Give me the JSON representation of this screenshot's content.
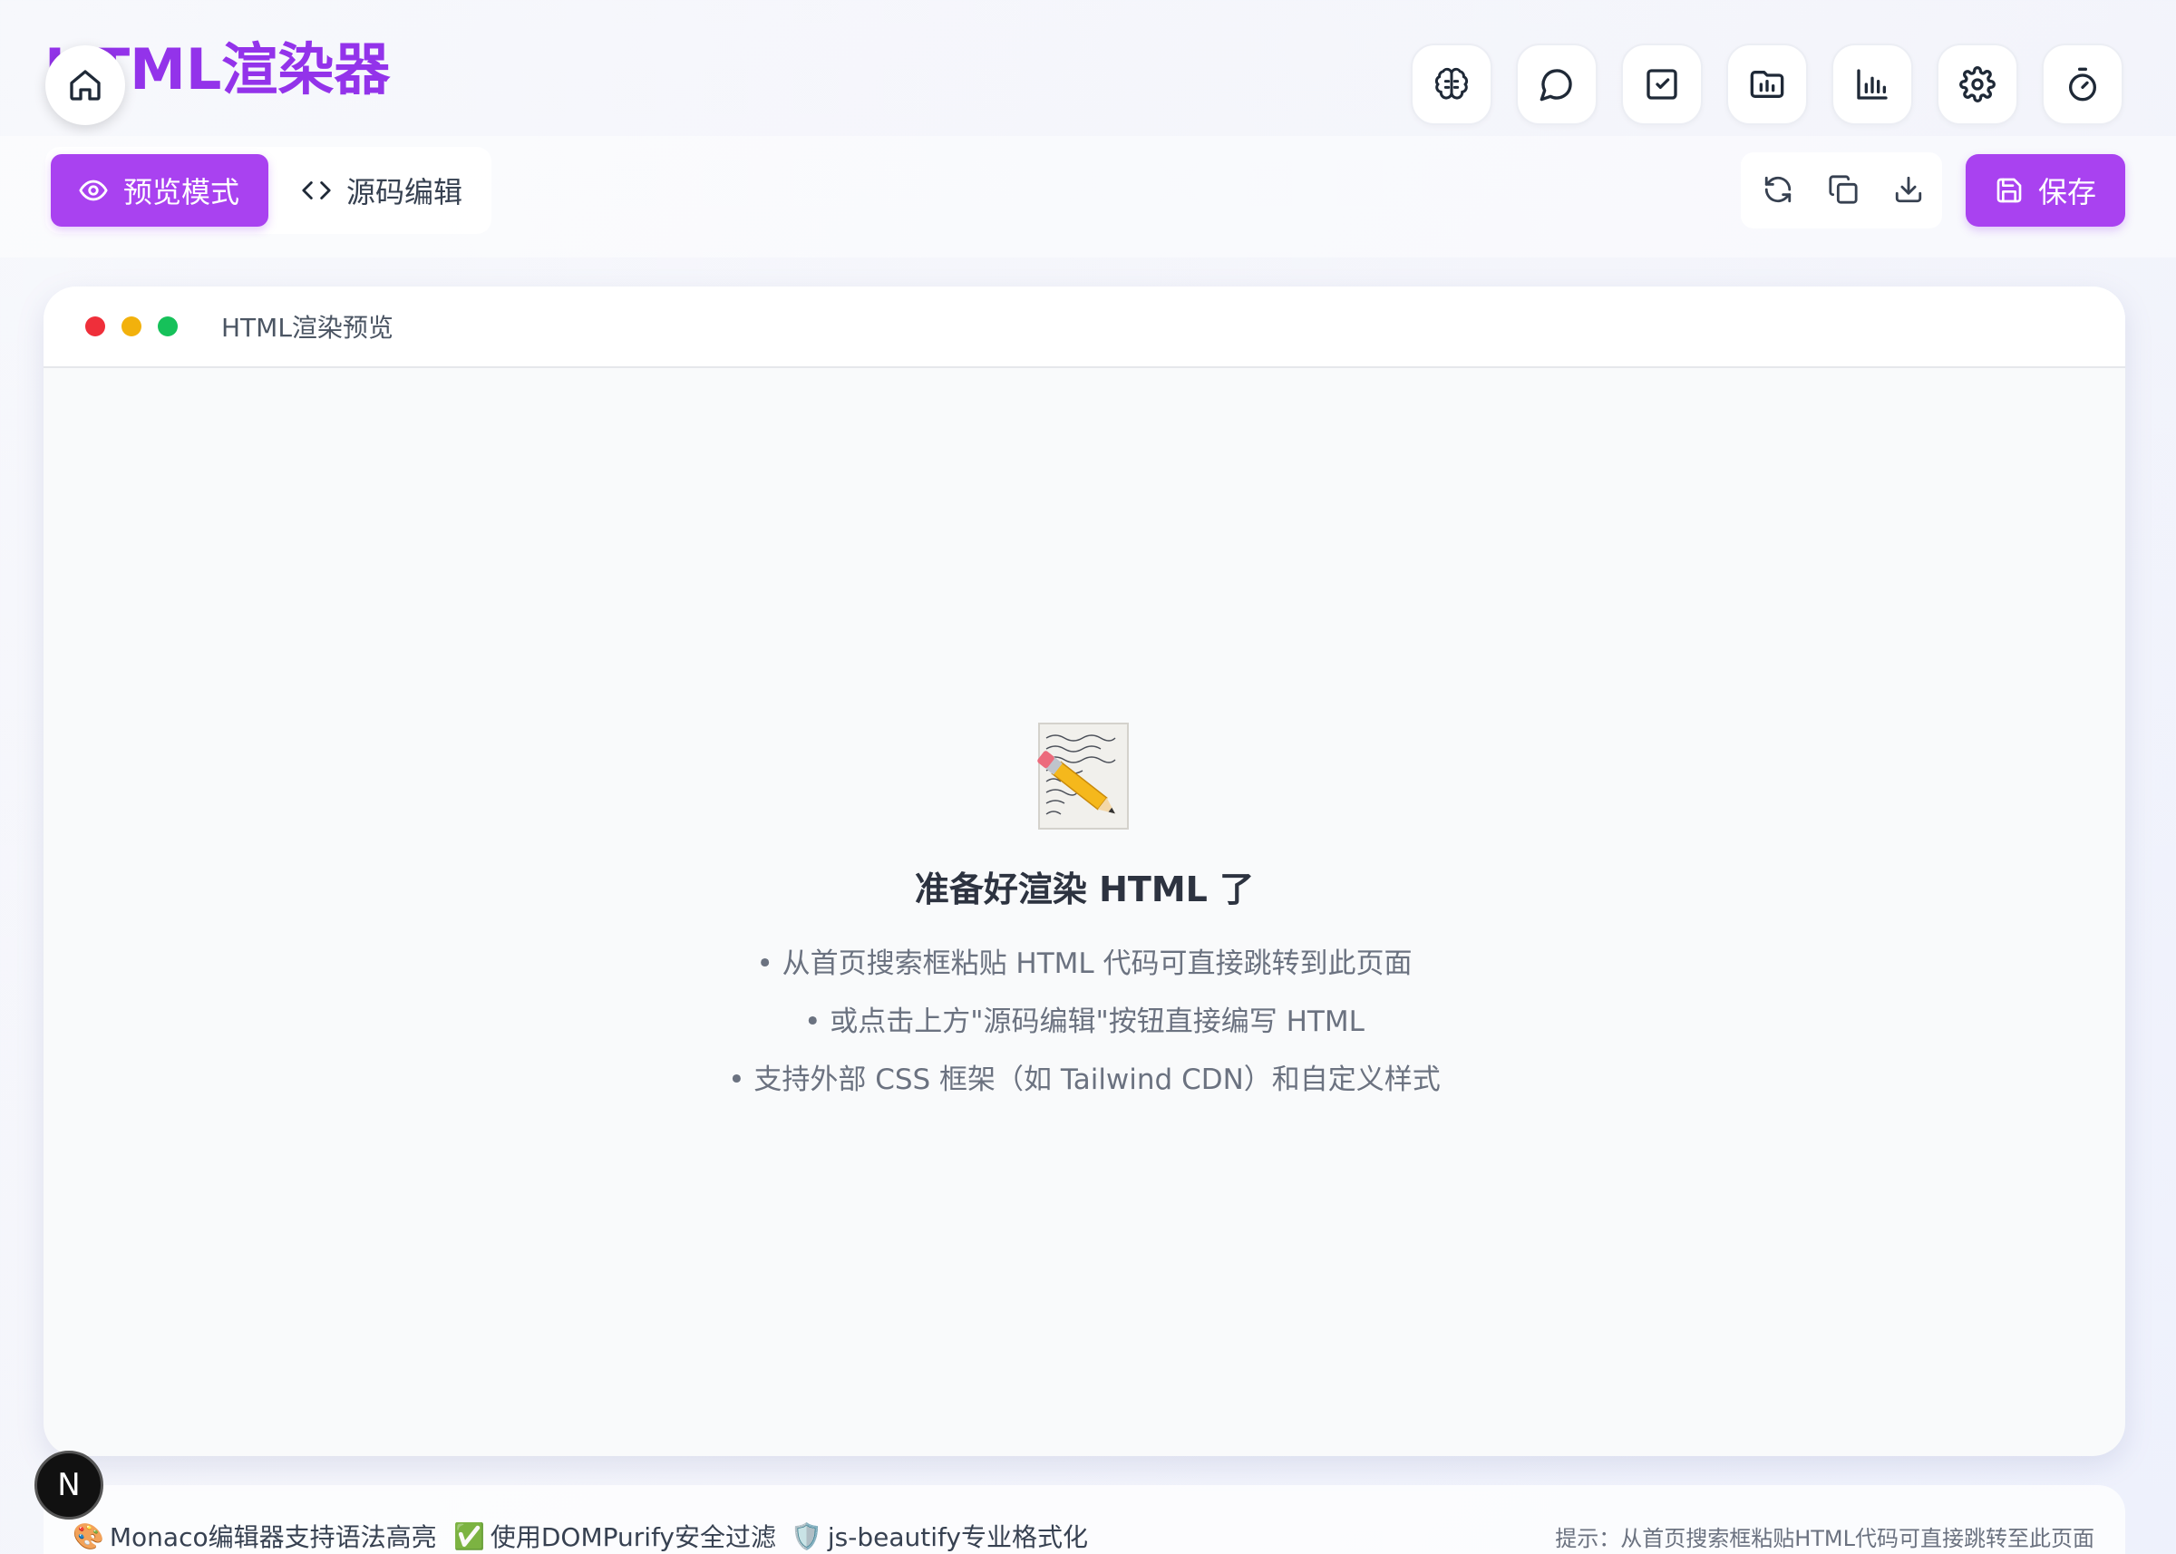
{
  "header": {
    "app_title": "HTML渲染器",
    "top_icons": [
      "brain-icon",
      "chat-bubble-icon",
      "checkbox-icon",
      "folder-chart-icon",
      "bar-chart-icon",
      "gear-icon",
      "timer-icon"
    ]
  },
  "toolbar": {
    "preview_label": "预览模式",
    "source_label": "源码编辑",
    "save_label": "保存",
    "action_icons": [
      "refresh-icon",
      "copy-icon",
      "download-icon"
    ]
  },
  "preview": {
    "window_title": "HTML渲染预览",
    "empty_title": "准备好渲染 HTML 了",
    "tips": [
      "• 从首页搜索框粘贴 HTML 代码可直接跳转到此页面",
      "• 或点击上方\"源码编辑\"按钮直接编写 HTML",
      "• 支持外部 CSS 框架（如 Tailwind CDN）和自定义样式"
    ]
  },
  "footer": {
    "features": [
      {
        "icon": "🎨",
        "text": "Monaco编辑器支持语法高亮"
      },
      {
        "icon": "✅",
        "text": "使用DOMPurify安全过滤"
      },
      {
        "icon": "🛡️",
        "text": "js-beautify专业格式化"
      }
    ],
    "hint": "提示：从首页搜索框粘贴HTML代码可直接跳转至此页面"
  },
  "badge": {
    "letter": "N"
  },
  "colors": {
    "accent": "#a942f0",
    "title": "#9333ea",
    "dot_red": "#ef2f3a",
    "dot_yellow": "#f2b10c",
    "dot_green": "#16c15a"
  }
}
